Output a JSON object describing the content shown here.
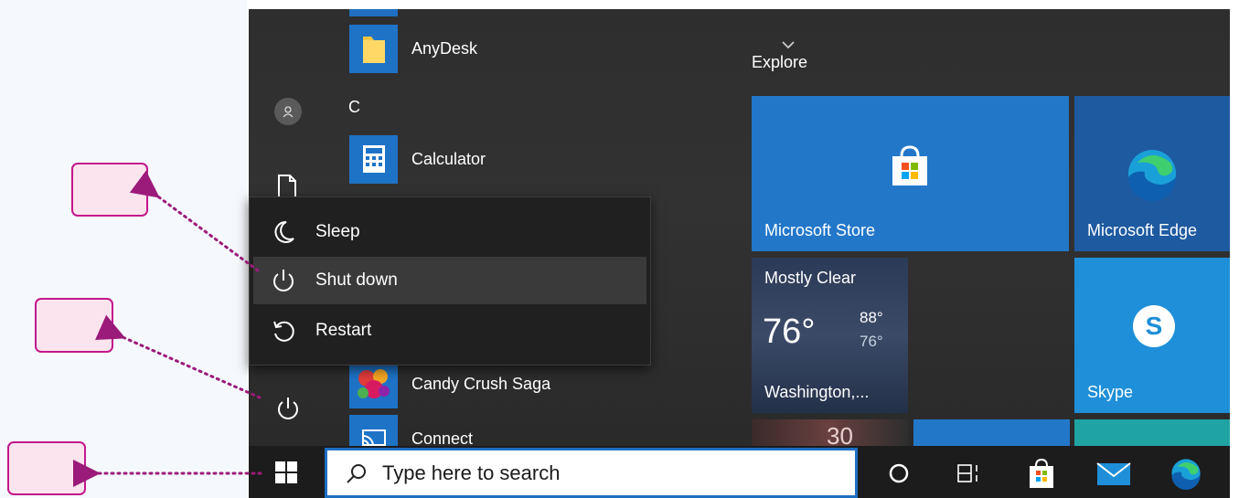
{
  "start_menu": {
    "apps": [
      {
        "label": "AnyDesk",
        "icon": "folder-icon"
      },
      {
        "label": "Calculator",
        "icon": "calculator-icon"
      },
      {
        "label": "Candy Crush Saga",
        "icon": "candy-crush-icon"
      },
      {
        "label": "Connect",
        "icon": "connect-icon"
      }
    ],
    "letter_header": "C",
    "rail_icons": [
      "user-avatar-icon",
      "documents-icon",
      "power-icon"
    ]
  },
  "power_menu": {
    "items": [
      {
        "label": "Sleep",
        "icon": "moon-icon"
      },
      {
        "label": "Shut down",
        "icon": "power-icon",
        "highlighted": true
      },
      {
        "label": "Restart",
        "icon": "restart-icon"
      }
    ]
  },
  "tiles": {
    "group_title": "Explore",
    "microsoft_store": "Microsoft Store",
    "microsoft_edge": "Microsoft Edge",
    "skype": "Skype",
    "weather": {
      "condition": "Mostly Clear",
      "temperature": "76°",
      "high": "88°",
      "low": "76°",
      "location": "Washington,..."
    },
    "weather_peek_text": "30"
  },
  "taskbar": {
    "search_placeholder": "Type here to search",
    "icons": [
      "cortana-icon",
      "task-view-icon",
      "store-icon",
      "mail-icon",
      "edge-icon"
    ]
  },
  "colors": {
    "accent": "#1e73c7",
    "callout_fill": "#fce4ef",
    "callout_border": "#c2188b",
    "arrow": "#9b1b7a"
  }
}
